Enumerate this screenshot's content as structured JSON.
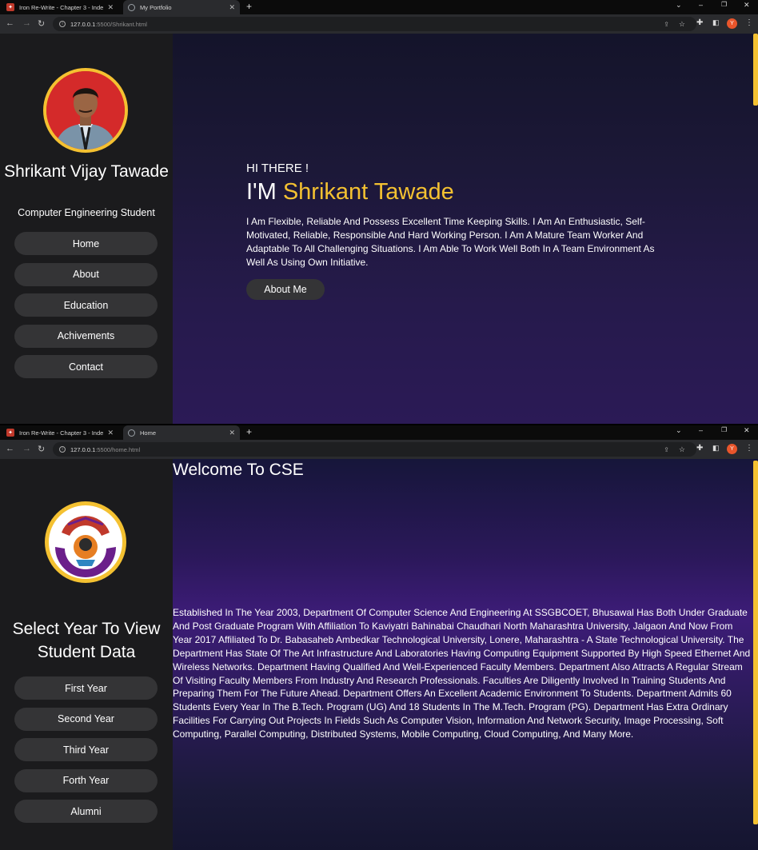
{
  "screen1": {
    "tabs": [
      {
        "title": "Iron Re-Write - Chapter 3 - Inde",
        "active": false
      },
      {
        "title": "My Portfolio",
        "active": true
      }
    ],
    "url": {
      "host": "127.0.0.1",
      "port": ":5500",
      "path": "/Shrikant.html"
    },
    "profile_initial": "Y",
    "sidebar": {
      "name": "Shrikant Vijay Tawade",
      "role": "Computer Engineering Student",
      "nav": [
        "Home",
        "About",
        "Education",
        "Achivements",
        "Contact"
      ]
    },
    "hero": {
      "greeting": "HI THERE !",
      "prefix": "I'M",
      "name": "Shrikant Tawade",
      "intro": "I Am Flexible, Reliable And Possess Excellent Time Keeping Skills. I Am An Enthusiastic, Self-Motivated, Reliable, Responsible And Hard Working Person. I Am A Mature Team Worker And Adaptable To All Challenging Situations. I Am Able To Work Well Both In A Team Environment As Well As Using Own Initiative.",
      "button": "About Me"
    },
    "accent_color": "#f4c131"
  },
  "screen2": {
    "tabs": [
      {
        "title": "Iron Re-Write - Chapter 3 - Inde",
        "active": false
      },
      {
        "title": "Home",
        "active": true
      }
    ],
    "url": {
      "host": "127.0.0.1",
      "port": ":5500",
      "path": "/home.html"
    },
    "profile_initial": "Y",
    "sidebar": {
      "heading": "Select Year To View Student Data",
      "nav": [
        "First Year",
        "Second Year",
        "Third Year",
        "Forth Year",
        "Alumni"
      ]
    },
    "main": {
      "title": "Welcome To CSE",
      "description": "Established In The Year 2003, Department Of Computer Science And Engineering At SSGBCOET, Bhusawal Has Both Under Graduate And Post Graduate Program With Affiliation To Kaviyatri Bahinabai Chaudhari North Maharashtra University, Jalgaon And Now From Year 2017 Affiliated To Dr. Babasaheb Ambedkar Technological University, Lonere, Maharashtra - A State Technological University. The Department Has State Of The Art Infrastructure And Laboratories Having Computing Equipment Supported By High Speed Ethernet And Wireless Networks. Department Having Qualified And Well-Experienced Faculty Members. Department Also Attracts A Regular Stream Of Visiting Faculty Members From Industry And Research Professionals. Faculties Are Diligently Involved In Training Students And Preparing Them For The Future Ahead. Department Offers An Excellent Academic Environment To Students. Department Admits 60 Students Every Year In The B.Tech. Program (UG) And 18 Students In The M.Tech. Program (PG). Department Has Extra Ordinary Facilities For Carrying Out Projects In Fields Such As Computer Vision, Information And Network Security, Image Processing, Soft Computing, Parallel Computing, Distributed Systems, Mobile Computing, Cloud Computing, And Many More."
    }
  }
}
